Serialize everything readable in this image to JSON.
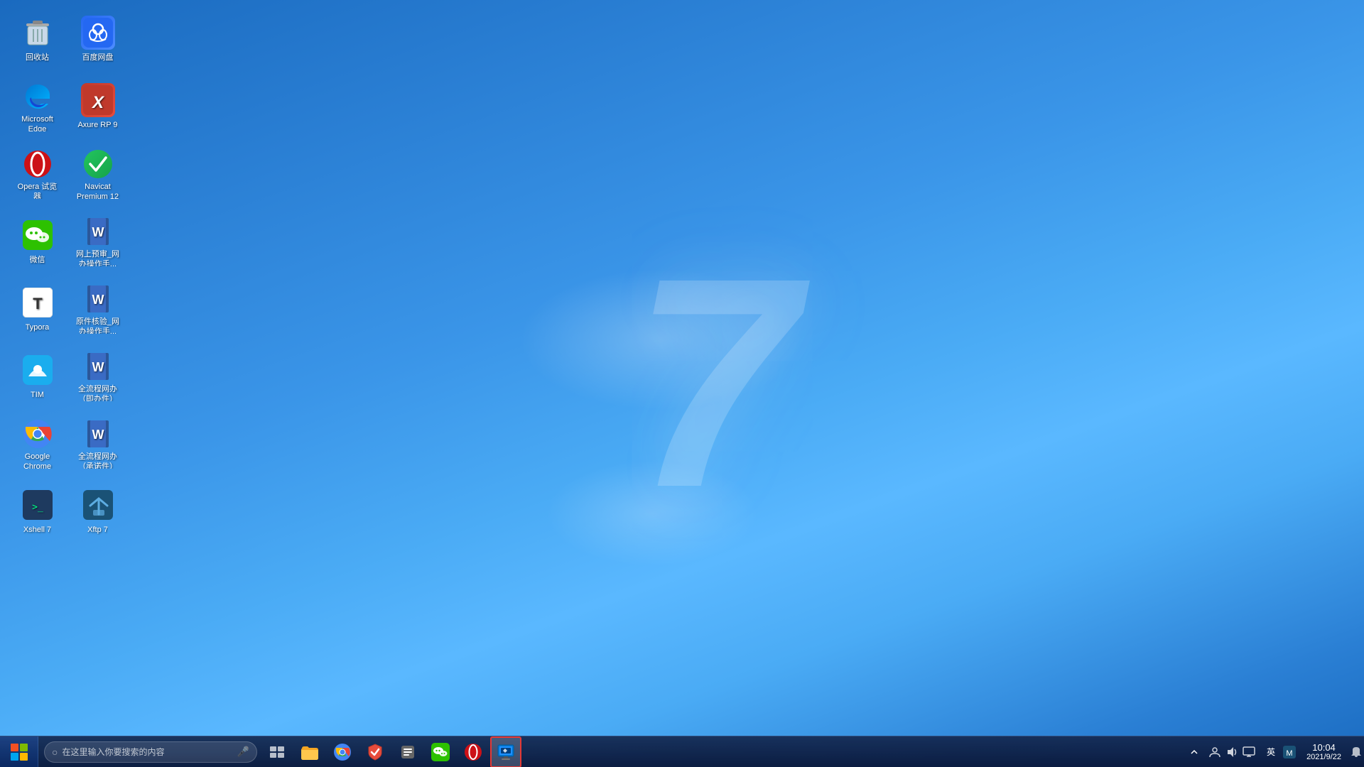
{
  "desktop": {
    "background_desc": "Windows 7 blue gradient with large 7 watermark",
    "win7_number": "7"
  },
  "icons": [
    {
      "id": "recycle-bin",
      "label": "回收站",
      "icon_type": "recycle",
      "col": 1,
      "row": 1
    },
    {
      "id": "baidu-pan",
      "label": "百度网盘",
      "icon_type": "baidu",
      "col": 2,
      "row": 1
    },
    {
      "id": "microsoft-edge",
      "label": "Microsoft Edge",
      "icon_type": "edge",
      "col": 1,
      "row": 2
    },
    {
      "id": "axure-rp9",
      "label": "Axure RP 9",
      "icon_type": "axure",
      "col": 2,
      "row": 2
    },
    {
      "id": "opera",
      "label": "Opera 试览器",
      "icon_type": "opera",
      "col": 1,
      "row": 3
    },
    {
      "id": "navicat",
      "label": "Navicat Premium 12",
      "icon_type": "navicat",
      "col": 2,
      "row": 3
    },
    {
      "id": "wechat",
      "label": "微信",
      "icon_type": "wechat",
      "col": 1,
      "row": 4
    },
    {
      "id": "doc1",
      "label": "网上预审_网办操作手...",
      "icon_type": "word",
      "col": 2,
      "row": 4
    },
    {
      "id": "typora",
      "label": "Typora",
      "icon_type": "typora",
      "col": 1,
      "row": 5
    },
    {
      "id": "doc2",
      "label": "原件核验_网办操作手...",
      "icon_type": "word",
      "col": 2,
      "row": 5
    },
    {
      "id": "tim",
      "label": "TIM",
      "icon_type": "tim",
      "col": 1,
      "row": 6
    },
    {
      "id": "doc3",
      "label": "全流程网办（即办件）_...",
      "icon_type": "word",
      "col": 2,
      "row": 6
    },
    {
      "id": "google-chrome",
      "label": "Google Chrome",
      "icon_type": "chrome",
      "col": 1,
      "row": 7
    },
    {
      "id": "doc4",
      "label": "全流程网办（承诺件）_...",
      "icon_type": "word",
      "col": 2,
      "row": 7
    },
    {
      "id": "xshell7",
      "label": "Xshell 7",
      "icon_type": "xshell",
      "col": 1,
      "row": 8
    },
    {
      "id": "xftp7",
      "label": "Xftp 7",
      "icon_type": "xftp",
      "col": 2,
      "row": 8
    }
  ],
  "taskbar": {
    "search_placeholder": "在这里输入你要搜索的内容",
    "apps": [
      {
        "id": "file-explorer",
        "label": "文件资源管理器",
        "icon": "folder"
      },
      {
        "id": "chrome-tb",
        "label": "Google Chrome",
        "icon": "chrome"
      },
      {
        "id": "security",
        "label": "安全软件",
        "icon": "shield"
      },
      {
        "id": "tools",
        "label": "工具",
        "icon": "tools"
      },
      {
        "id": "wechat-tb",
        "label": "微信",
        "icon": "wechat"
      },
      {
        "id": "opera-tb",
        "label": "Opera",
        "icon": "opera"
      },
      {
        "id": "rdp",
        "label": "远程桌面",
        "icon": "rdp",
        "active": true,
        "highlighted": true
      }
    ],
    "tray": {
      "expand_label": "^",
      "language": "英",
      "time": "10:04",
      "date": "2021/9/22"
    }
  }
}
